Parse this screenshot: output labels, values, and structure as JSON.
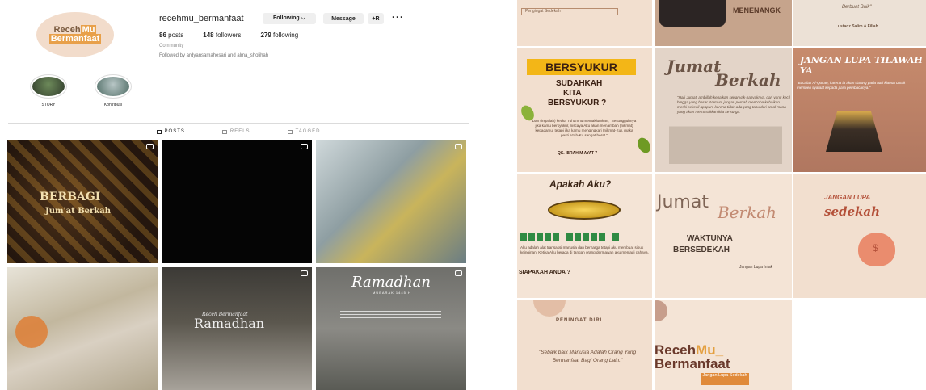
{
  "profile": {
    "avatar_line1_a": "Receh",
    "avatar_line1_b": "Mu",
    "avatar_line2_a": "Bermanfaat",
    "username": "recehmu_bermanfaat",
    "following_button": "Following ⌵",
    "message_button": "Message",
    "add_user_button": "+R",
    "more_button": "···",
    "posts_count": "86",
    "posts_label": "posts",
    "followers_count": "148",
    "followers_label": "followers",
    "following_count": "279",
    "following_label": "following",
    "category": "Community",
    "followed_by": "Followed by ardyansamahesari and alma_sholihah"
  },
  "highlights": [
    {
      "label": "STORY"
    },
    {
      "label": "Kontribusi"
    }
  ],
  "tabs": [
    {
      "label": "POSTS"
    },
    {
      "label": "REELS"
    },
    {
      "label": "TAGGED"
    }
  ],
  "posts": {
    "p1_title": "BERBAGI",
    "p1_sub": "Jum'at Berkah",
    "p5_small": "Receh Bermanfaat",
    "p5_title": "Ramadhan",
    "p6_title": "Ramadhan",
    "p6_sub": "MUBARAK 1445 H"
  },
  "feed": {
    "r0c1": "Pengingat Sedekah",
    "r0c2": "MENENANGK",
    "r0c3_quote": "Berbuat Baik\"",
    "r0c3_author": "ustadz Salim A Fillah",
    "r1c1_banner": "BERSYUKUR",
    "r1c1_l1": "SUDAHKAH",
    "r1c1_l2": "KITA",
    "r1c1_l3": "BERSYUKUR ?",
    "r1c1_text": "Dan (ingatlah) ketika Tuhanmu memaklumkan, \"Sesungguhnya jika kamu bersyukur, niscaya Aku akan menambah (nikmat) kepadamu, tetapi jika kamu mengingkari (nikmat-Ku), maka pasti azab-Ku sangat berat.\"",
    "r1c1_author": "QS. IBRAHIM AYAT 7",
    "r1c2_title1": "Jumat",
    "r1c2_title2": "Berkah",
    "r1c2_text": "\"Hari Jumat, ambillah kebaikan sebanyak-banyaknya, dari yang kecil hingga yang besar. Namun, jangan pernah mencoba kebaikan meski sekecil apapun, karena tidak ada yang tahu dari amal mana yang akan memasukkan kita ke surga.\"",
    "r1c3_title": "JANGAN LUPA TILAWAH YA",
    "r1c3_text": "\"Bacalah Al-Qur'an, karena ia akan datang pada hari kiamat untuk memberi syafaat kepada para pembacanya.\"",
    "r2c1_title": "Apakah Aku?",
    "r2c1_text": "Aku adalah alat transaksi manusia dan berharga tetapi aku membuat sibuk keinginan. Ketika Aku berada di tangan orang dermawan aku menjadi cahaya.",
    "r2c1_q": "SIAPAKAH ANDA ?",
    "r2c2_title1": "Jumat",
    "r2c2_title2": "Berkah",
    "r2c2_sub1": "WAKTUNYA",
    "r2c2_sub2": "BERSEDEKAH",
    "r2c2_footer": "Jangan Lupa Infak",
    "r2c3_title1": "JANGAN LUPA",
    "r2c3_title2": "sedekah",
    "r3c1_title": "PENINGAT DIRI",
    "r3c1_quote": "\"Sebaik baik Manusia Adalah Orang Yang Bermanfaat Bagi Orang Lain.\"",
    "r3c2_line1_a": "Receh",
    "r3c2_line1_b": "Mu_",
    "r3c2_line2": "Bermanfaat",
    "r3c2_badge": "Jangan Lupa Sedekah"
  }
}
